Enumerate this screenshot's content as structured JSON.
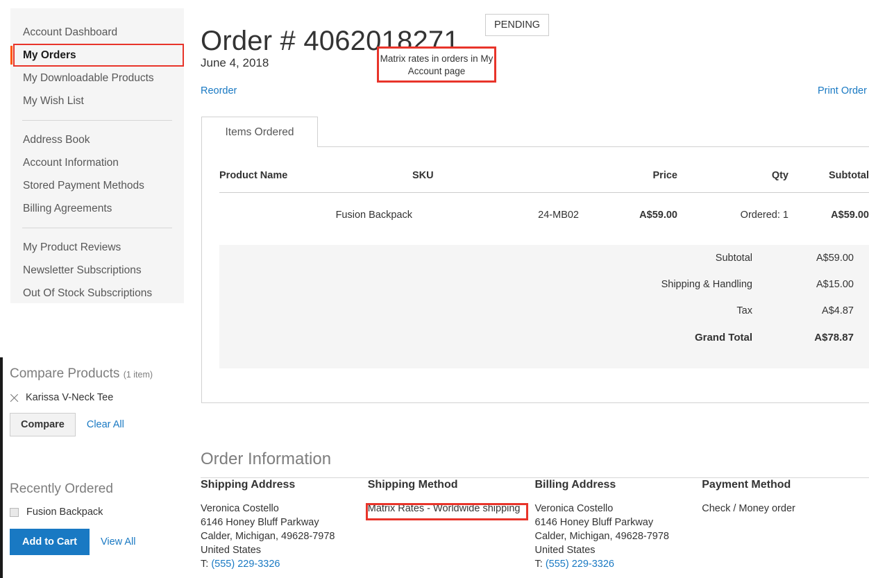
{
  "sidebar": {
    "groups": [
      {
        "items": [
          {
            "label": "Account Dashboard",
            "current": false
          },
          {
            "label": "My Orders",
            "current": true
          },
          {
            "label": "My Downloadable Products",
            "current": false
          },
          {
            "label": "My Wish List",
            "current": false
          }
        ]
      },
      {
        "items": [
          {
            "label": "Address Book",
            "current": false
          },
          {
            "label": "Account Information",
            "current": false
          },
          {
            "label": "Stored Payment Methods",
            "current": false
          },
          {
            "label": "Billing Agreements",
            "current": false
          }
        ]
      },
      {
        "items": [
          {
            "label": "My Product Reviews",
            "current": false
          },
          {
            "label": "Newsletter Subscriptions",
            "current": false
          },
          {
            "label": "Out Of Stock Subscriptions",
            "current": false
          }
        ]
      }
    ]
  },
  "compare_block": {
    "title": "Compare Products",
    "count": "(1 item)",
    "product": "Karissa V-Neck Tee",
    "remove_icon": "close-icon",
    "compare_button": "Compare",
    "clear_all": "Clear All"
  },
  "recently_ordered": {
    "title": "Recently Ordered",
    "product": "Fusion Backpack",
    "add_to_cart": "Add to Cart",
    "view_all": "View All"
  },
  "order": {
    "title": "Order # 4062018271",
    "status": "PENDING",
    "date": "June 4, 2018",
    "reorder": "Reorder",
    "print_order": "Print Order"
  },
  "annotations": {
    "header_note": "Matrix rates in orders in My Account page",
    "shipping_note": "Matrix Rates - Worldwide shipping"
  },
  "tabs": {
    "items_ordered": "Items Ordered"
  },
  "items_table": {
    "headers": [
      "Product Name",
      "SKU",
      "Price",
      "Qty",
      "Subtotal"
    ],
    "rows": [
      {
        "product_name": "Fusion Backpack",
        "sku": "24-MB02",
        "price": "A$59.00",
        "qty": "Ordered: 1",
        "subtotal": "A$59.00"
      }
    ]
  },
  "totals": {
    "rows": [
      {
        "label": "Subtotal",
        "value": "A$59.00",
        "grand": false
      },
      {
        "label": "Shipping & Handling",
        "value": "A$15.00",
        "grand": false
      },
      {
        "label": "Tax",
        "value": "A$4.87",
        "grand": false
      },
      {
        "label": "Grand Total",
        "value": "A$78.87",
        "grand": true
      }
    ]
  },
  "order_information": {
    "title": "Order Information",
    "shipping_address": {
      "heading": "Shipping Address",
      "name": "Veronica Costello",
      "street": "6146 Honey Bluff Parkway",
      "city_line": "Calder, Michigan, 49628-7978",
      "country": "United States",
      "phone_prefix": "T: ",
      "phone": "(555) 229-3326"
    },
    "shipping_method": {
      "heading": "Shipping Method",
      "value": "Matrix Rates - Worldwide shipping"
    },
    "billing_address": {
      "heading": "Billing Address",
      "name": "Veronica Costello",
      "street": "6146 Honey Bluff Parkway",
      "city_line": "Calder, Michigan, 49628-7978",
      "country": "United States",
      "phone_prefix": "T: ",
      "phone": "(555) 229-3326"
    },
    "payment_method": {
      "heading": "Payment Method",
      "value": "Check / Money order"
    }
  },
  "colors": {
    "link": "#1979c3",
    "accent_orange": "#ff5501",
    "annotation_red": "#e8342a",
    "panel_gray": "#f5f5f5"
  }
}
